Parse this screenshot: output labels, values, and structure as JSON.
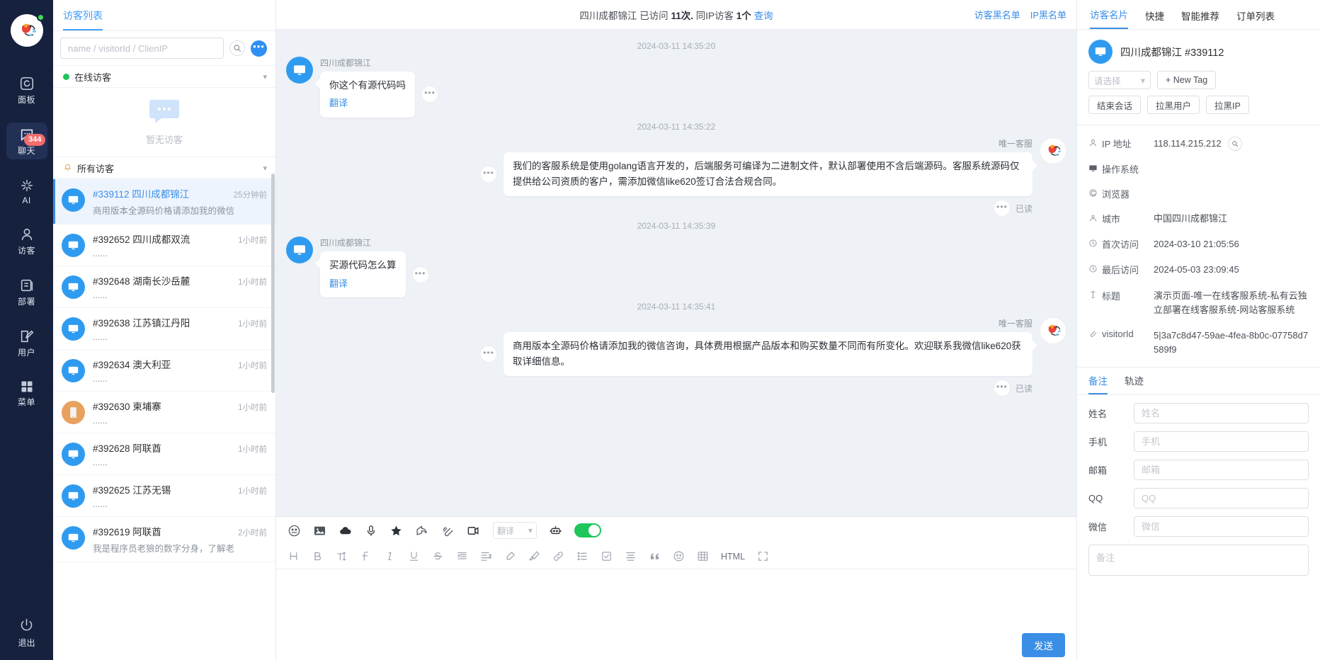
{
  "rail": {
    "items": [
      {
        "label": "面板",
        "icon": "dashboard-icon",
        "badge": null
      },
      {
        "label": "聊天",
        "icon": "chat-icon",
        "badge": "344"
      },
      {
        "label": "AI",
        "icon": "ai-sparkle-icon",
        "badge": null
      },
      {
        "label": "访客",
        "icon": "user-icon",
        "badge": null
      },
      {
        "label": "部署",
        "icon": "deploy-icon",
        "badge": null
      },
      {
        "label": "用户",
        "icon": "edit-user-icon",
        "badge": null
      },
      {
        "label": "菜单",
        "icon": "grid-menu-icon",
        "badge": null
      }
    ],
    "logout_label": "退出"
  },
  "visitor_list": {
    "tab_label": "访客列表",
    "search_placeholder": "name / visitorId / ClienIP",
    "search_value": "",
    "online_group": {
      "label": "在线访客",
      "empty_text": "暂无访客"
    },
    "all_group": {
      "label": "所有访客"
    },
    "items": [
      {
        "id": "#339112",
        "name": "四川成都锦江",
        "preview": "商用版本全源码价格请添加我的微信",
        "time": "25分钟前",
        "device": "desktop",
        "selected": true
      },
      {
        "id": "#392652",
        "name": "四川成都双流",
        "preview": "......",
        "time": "1小时前",
        "device": "desktop",
        "selected": false
      },
      {
        "id": "#392648",
        "name": "湖南长沙岳麓",
        "preview": "......",
        "time": "1小时前",
        "device": "desktop",
        "selected": false
      },
      {
        "id": "#392638",
        "name": "江苏镇江丹阳",
        "preview": "......",
        "time": "1小时前",
        "device": "desktop",
        "selected": false
      },
      {
        "id": "#392634",
        "name": "澳大利亚",
        "preview": "......",
        "time": "1小时前",
        "device": "desktop",
        "selected": false
      },
      {
        "id": "#392630",
        "name": "柬埔寨",
        "preview": "......",
        "time": "1小时前",
        "device": "mobile",
        "selected": false
      },
      {
        "id": "#392628",
        "name": "阿联酋",
        "preview": "......",
        "time": "1小时前",
        "device": "desktop",
        "selected": false
      },
      {
        "id": "#392625",
        "name": "江苏无锡",
        "preview": "......",
        "time": "1小时前",
        "device": "desktop",
        "selected": false
      },
      {
        "id": "#392619",
        "name": "阿联酋",
        "preview": "我是程序员老狼的数字分身，了解老",
        "time": "2小时前",
        "device": "desktop",
        "selected": false
      }
    ]
  },
  "chat": {
    "title_name": "四川成都锦江",
    "title_visited_label": "已访问",
    "title_visit_count": "11次.",
    "title_sameip_label": "同IP访客",
    "title_sameip_count": "1个",
    "title_query_link": "查询",
    "header_links": [
      "访客黑名单",
      "IP黑名单"
    ],
    "messages": [
      {
        "time": "2024-03-11 14:35:20",
        "side": "in",
        "sender": "四川成都锦江",
        "text": "你这个有源代码吗",
        "translate": "翻译",
        "read": null
      },
      {
        "time": "2024-03-11 14:35:22",
        "side": "out",
        "sender": "唯一客服",
        "text": "我们的客服系统是使用golang语言开发的，后端服务可编译为二进制文件，默认部署使用不含后端源码。客服系统源码仅提供给公司资质的客户，需添加微信like620签订合法合规合同。",
        "translate": null,
        "read": "已读"
      },
      {
        "time": "2024-03-11 14:35:39",
        "side": "in",
        "sender": "四川成都锦江",
        "text": "买源代码怎么算",
        "translate": "翻译",
        "read": null
      },
      {
        "time": "2024-03-11 14:35:41",
        "side": "out",
        "sender": "唯一客服",
        "text": "商用版本全源码价格请添加我的微信咨询，具体费用根据产品版本和购买数量不同而有所变化。欢迎联系我微信like620获取详细信息。",
        "translate": null,
        "read": "已读"
      }
    ],
    "composer": {
      "translate_select": "翻译",
      "html_label": "HTML",
      "send_label": "发送",
      "toolbar_row1": [
        "emoji-icon",
        "image-icon",
        "cloud-upload-icon",
        "microphone-icon",
        "star-icon",
        "share-icon",
        "attachment-icon",
        "video-icon"
      ],
      "toolbar_row2": [
        "heading-icon",
        "bold-icon",
        "font-size-icon",
        "font-style-icon",
        "italic-icon",
        "underline-icon",
        "strikethrough-icon",
        "indent-icon",
        "line-height-icon",
        "highlighter-icon",
        "brush-icon",
        "link-icon",
        "bullet-list-icon",
        "checkbox-icon",
        "align-icon",
        "quote-icon",
        "smiley-icon",
        "table-icon"
      ],
      "input_value": ""
    }
  },
  "right_panel": {
    "tabs": [
      {
        "label": "访客名片",
        "active": true
      },
      {
        "label": "快捷",
        "active": false
      },
      {
        "label": "智能推荐",
        "active": false
      },
      {
        "label": "订单列表",
        "active": false
      }
    ],
    "visitor_name": "四川成都锦江",
    "visitor_id": "#339112",
    "tag_select_placeholder": "请选择",
    "new_tag_label": "+ New Tag",
    "actions": [
      "结束会话",
      "拉黑用户",
      "拉黑IP"
    ],
    "info": [
      {
        "icon": "ip-icon",
        "label": "IP 地址",
        "value": "118.114.215.212",
        "type": "link-search"
      },
      {
        "icon": "os-icon",
        "label": "操作系统",
        "value": "",
        "type": "text"
      },
      {
        "icon": "browser-icon",
        "label": "浏览器",
        "value": "",
        "type": "globe"
      },
      {
        "icon": "city-icon",
        "label": "城市",
        "value": "中国四川成都锦江",
        "type": "text"
      },
      {
        "icon": "clock-icon",
        "label": "首次访问",
        "value": "2024-03-10 21:05:56",
        "type": "text"
      },
      {
        "icon": "clock-icon",
        "label": "最后访问",
        "value": "2024-05-03 23:09:45",
        "type": "text"
      },
      {
        "icon": "title-icon",
        "label": "标题",
        "value": "演示页面-唯一在线客服系统-私有云独立部署在线客服系统-网站客服系统",
        "type": "text"
      },
      {
        "icon": "link-icon",
        "label": "visitorId",
        "value": "5|3a7c8d47-59ae-4fea-8b0c-07758d7589f9",
        "type": "text"
      }
    ],
    "sub_tabs": [
      {
        "label": "备注",
        "active": true
      },
      {
        "label": "轨迹",
        "active": false
      }
    ],
    "form": [
      {
        "label": "姓名",
        "placeholder": "姓名",
        "value": ""
      },
      {
        "label": "手机",
        "placeholder": "手机",
        "value": ""
      },
      {
        "label": "邮箱",
        "placeholder": "邮箱",
        "value": ""
      },
      {
        "label": "QQ",
        "placeholder": "QQ",
        "value": ""
      },
      {
        "label": "微信",
        "placeholder": "微信",
        "value": ""
      }
    ],
    "note_placeholder": "备注"
  },
  "colors": {
    "primary": "#3a8ee6",
    "rail_bg": "#16213e",
    "online_green": "#21c55d",
    "badge_red": "#f56c6c",
    "toggle_green": "#1fc65b"
  }
}
